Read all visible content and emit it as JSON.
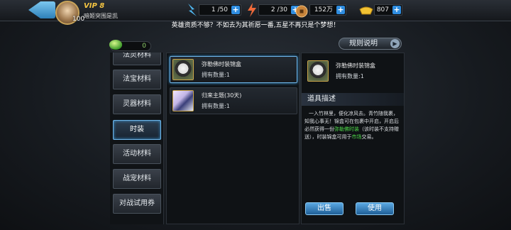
{
  "player": {
    "vip": "VIP 8",
    "level": "100",
    "guild": "暗姬突围是凯"
  },
  "resources": [
    {
      "value": "1 /50",
      "icon": "stamina-icon"
    },
    {
      "value": "2 /30",
      "icon": "energy-icon"
    },
    {
      "value": "152万",
      "icon": "coin-icon"
    },
    {
      "value": "807",
      "icon": "gold-ingot-icon"
    }
  ],
  "notice": "英雄资质不够？不如去为其祈愿一番,五星不再只是个梦想！",
  "gems": "0",
  "rules_label": "规则说明",
  "categories": [
    {
      "label": "法灵材料"
    },
    {
      "label": "法宝材料"
    },
    {
      "label": "灵器材料"
    },
    {
      "label": "时装"
    },
    {
      "label": "活动材料"
    },
    {
      "label": "战宠材料"
    },
    {
      "label": "对战试用券"
    }
  ],
  "active_category": 3,
  "items": [
    {
      "name": "弥勒佛时装锦盒",
      "qty": "拥有数量:1"
    },
    {
      "name": "归来主题(30天)",
      "qty": "拥有数量:1"
    }
  ],
  "detail": {
    "name": "弥勒佛时装锦盒",
    "qty": "拥有数量:1",
    "section_title": "道具描述",
    "desc_1": "一入竹林里，便化凉风去。青竹随我裹，知我心事无！锦盒可在包裹中开启，开启后必然获得一份",
    "desc_2": "弥勒佛时装",
    "desc_3": "（该时装不支持赠送），时装锦盒可用于",
    "desc_4": "市场",
    "desc_5": "交易。"
  },
  "buttons": {
    "sell": "出售",
    "use": "使用"
  },
  "colors": {
    "accent": "#3f9ad8",
    "highlight_text": "#4fdc4a",
    "vip": "#f5c542"
  }
}
